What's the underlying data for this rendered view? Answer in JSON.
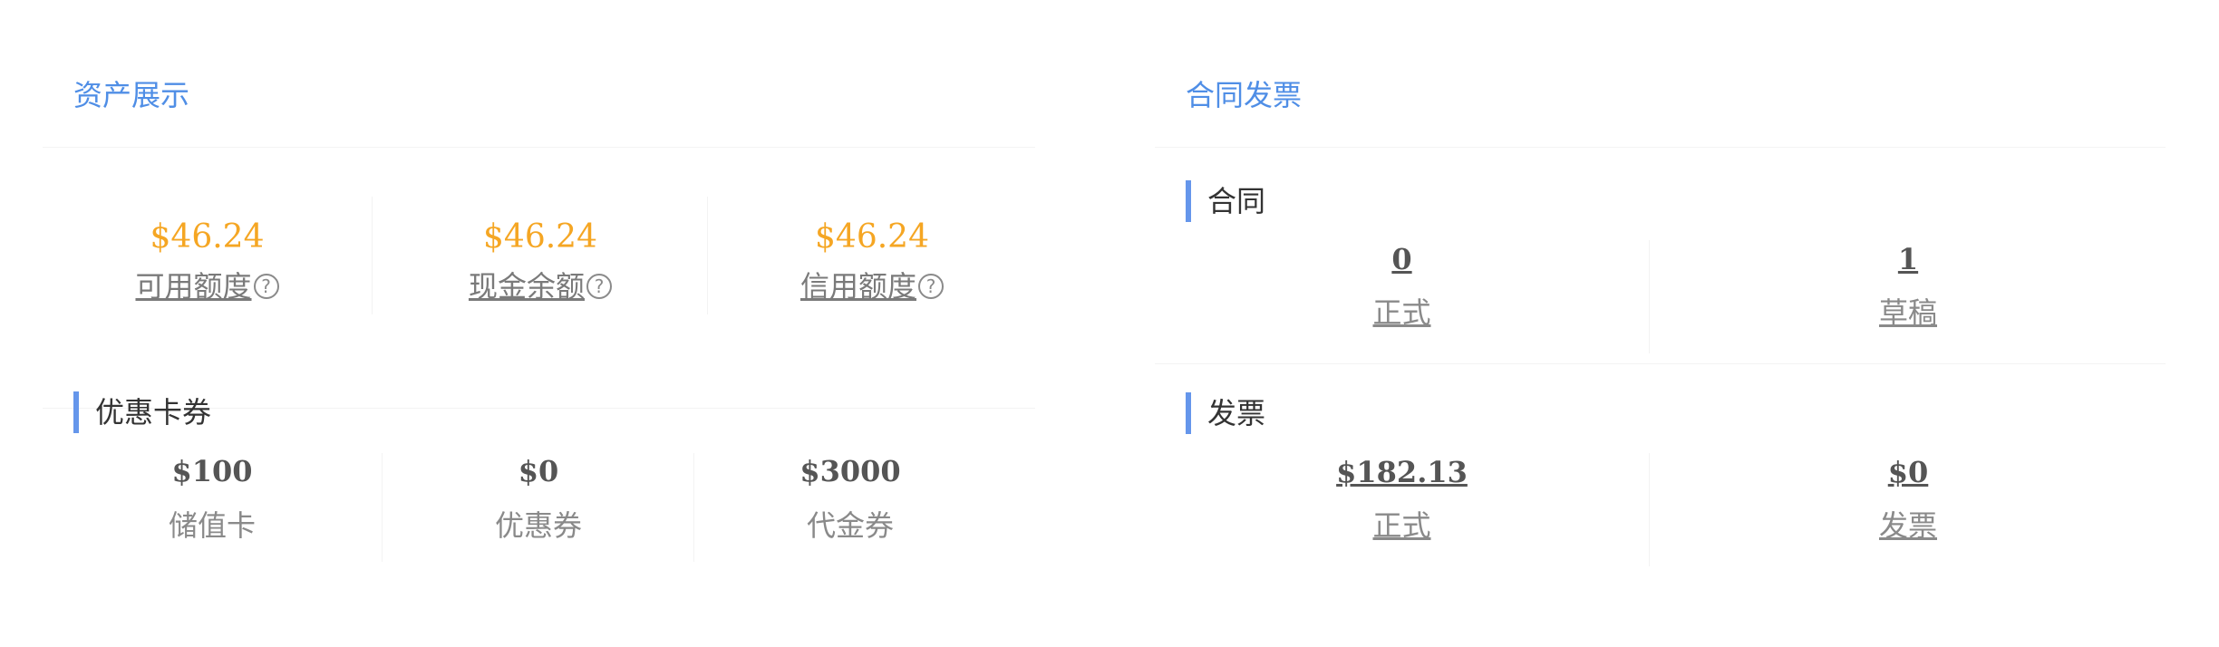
{
  "assets": {
    "title": "资产展示",
    "items": [
      {
        "value": "$46.24",
        "label": "可用额度",
        "help": "?"
      },
      {
        "value": "$46.24",
        "label": "现金余额",
        "help": "?"
      },
      {
        "value": "$46.24",
        "label": "信用额度",
        "help": "?"
      }
    ],
    "coupons": {
      "title": "优惠卡券",
      "items": [
        {
          "value": "$100",
          "label": "储值卡"
        },
        {
          "value": "$0",
          "label": "优惠券"
        },
        {
          "value": "$3000",
          "label": "代金券"
        }
      ]
    }
  },
  "contracts_invoices": {
    "title": "合同发票",
    "contracts": {
      "title": "合同",
      "items": [
        {
          "value": "0",
          "label": "正式"
        },
        {
          "value": "1",
          "label": "草稿"
        }
      ]
    },
    "invoices": {
      "title": "发票",
      "items": [
        {
          "value": "$182.13",
          "label": "正式"
        },
        {
          "value": "$0",
          "label": "发票"
        }
      ]
    }
  },
  "colors": {
    "title_blue": "#4f8ee6",
    "accent_bar": "#6596eb",
    "value_orange": "#f5a623"
  }
}
